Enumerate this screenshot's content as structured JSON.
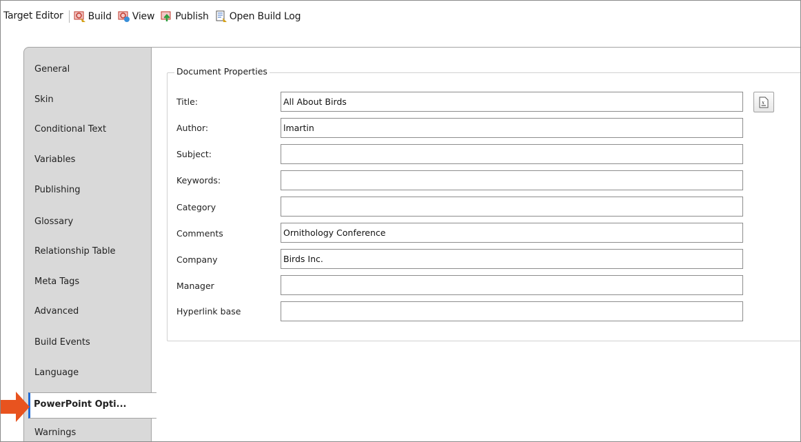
{
  "toolbar": {
    "title": "Target Editor",
    "build": "Build",
    "view": "View",
    "publish": "Publish",
    "open_build_log": "Open Build Log"
  },
  "tabs": [
    "General",
    "Skin",
    "Conditional Text",
    "Variables",
    "Publishing",
    "Glossary",
    "Relationship Table",
    "Meta Tags",
    "Advanced",
    "Build Events",
    "Language",
    "PowerPoint Opti...",
    "Warnings"
  ],
  "active_tab": "PowerPoint Opti...",
  "group": {
    "title": "Document Properties",
    "fields": [
      {
        "label": "Title:",
        "value": "All About Birds"
      },
      {
        "label": "Author:",
        "value": "lmartin"
      },
      {
        "label": "Subject:",
        "value": ""
      },
      {
        "label": "Keywords:",
        "value": ""
      },
      {
        "label": "Category",
        "value": ""
      },
      {
        "label": "Comments",
        "value": "Ornithology Conference"
      },
      {
        "label": "Company",
        "value": "Birds Inc."
      },
      {
        "label": "Manager",
        "value": ""
      },
      {
        "label": "Hyperlink base",
        "value": ""
      }
    ]
  },
  "colors": {
    "accent": "#1f6bd6",
    "arrow": "#e8531f",
    "tab_bg": "#d9d9d9"
  }
}
